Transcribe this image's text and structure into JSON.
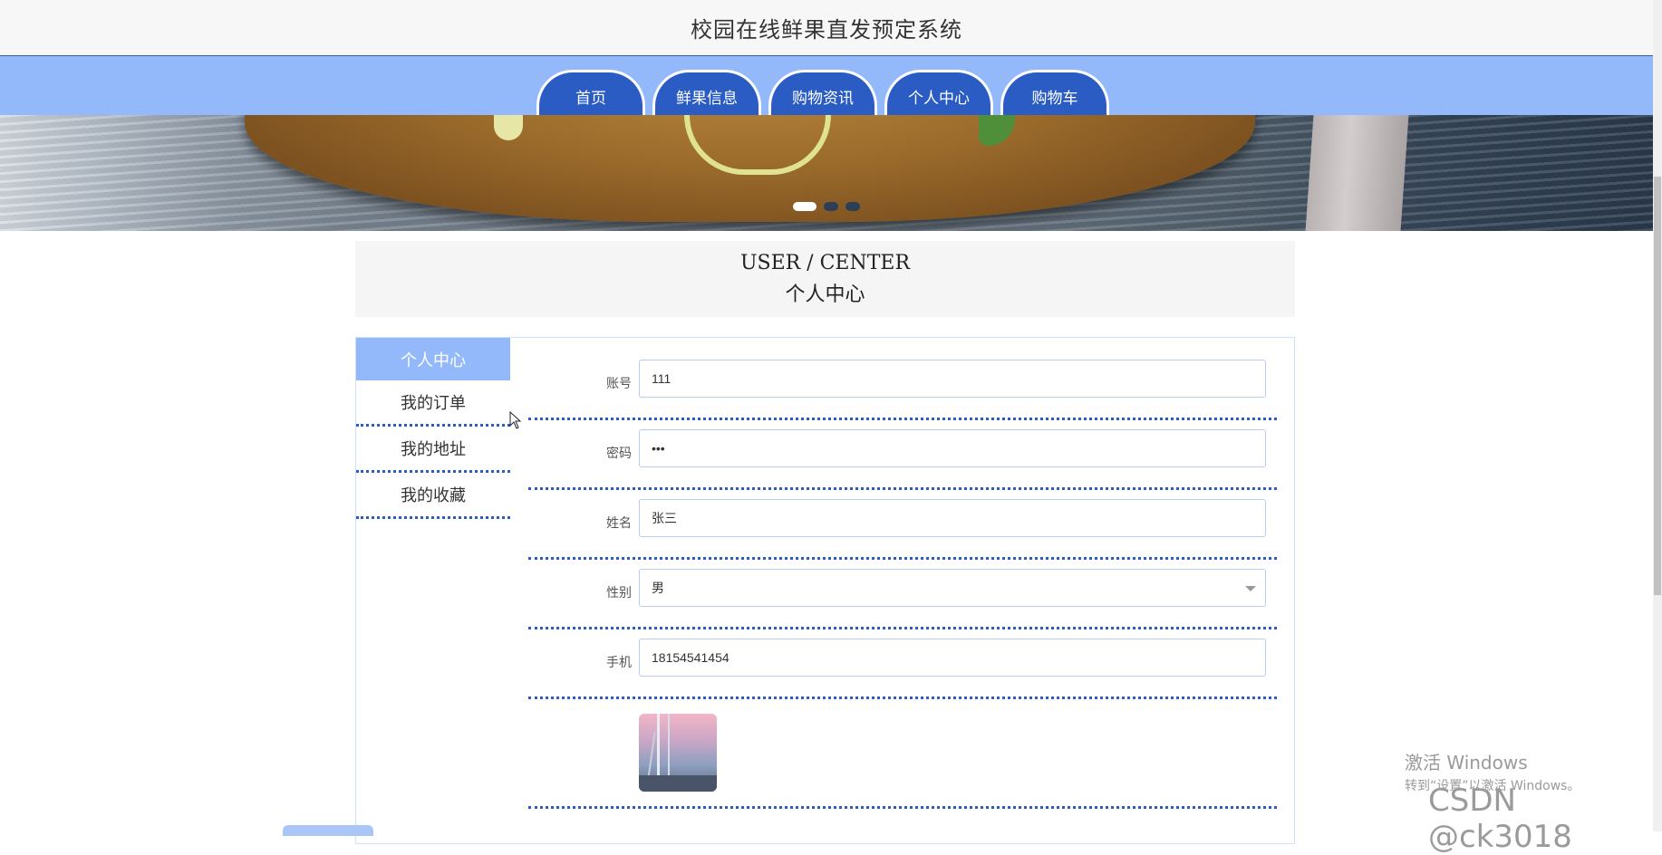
{
  "site": {
    "title": "校园在线鲜果直发预定系统"
  },
  "nav": {
    "items": [
      {
        "label": "首页"
      },
      {
        "label": "鲜果信息"
      },
      {
        "label": "购物资讯"
      },
      {
        "label": "个人中心"
      },
      {
        "label": "购物车"
      }
    ]
  },
  "banner": {
    "slide_count": 3,
    "active_slide": 1
  },
  "section": {
    "title_en": "USER / CENTER",
    "title_zh": "个人中心"
  },
  "sidebar": {
    "items": [
      {
        "label": "个人中心",
        "active": true
      },
      {
        "label": "我的订单"
      },
      {
        "label": "我的地址"
      },
      {
        "label": "我的收藏"
      }
    ]
  },
  "form": {
    "account": {
      "label": "账号",
      "value": "111"
    },
    "password": {
      "label": "密码",
      "value": "•••"
    },
    "name": {
      "label": "姓名",
      "value": "张三"
    },
    "gender": {
      "label": "性别",
      "value": "男"
    },
    "phone": {
      "label": "手机",
      "value": "18154541454"
    }
  },
  "watermark": {
    "line1": "激活 Windows",
    "line2": "转到“设置”以激活 Windows。",
    "csdn": "CSDN @ck3018"
  },
  "colors": {
    "primary": "#2a5cc4",
    "nav_bg": "#94b9fb",
    "active_bg": "#94b9fb"
  }
}
